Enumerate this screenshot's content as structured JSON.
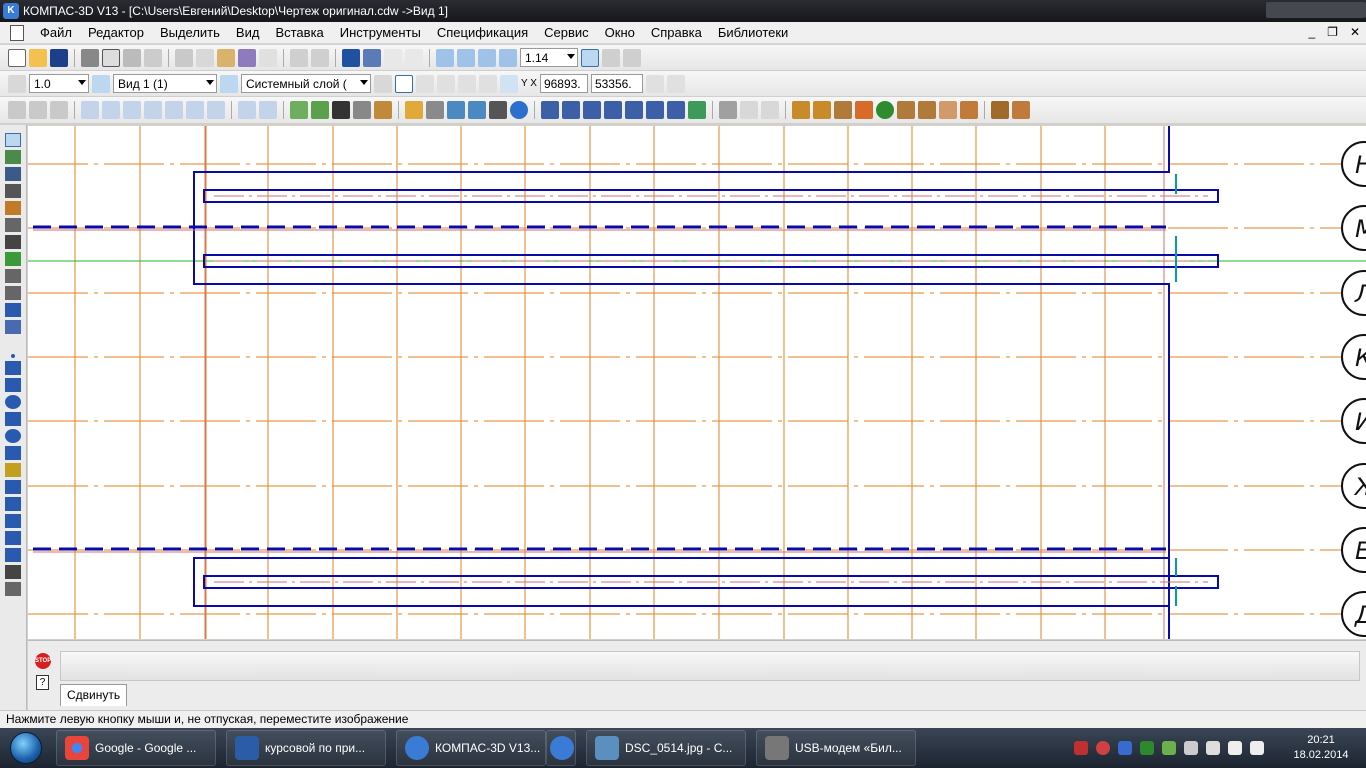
{
  "window": {
    "title": "КОМПАС-3D V13 - [C:\\Users\\Евгений\\Desktop\\Чертеж оригинал.cdw ->Вид 1]"
  },
  "menu": {
    "items": [
      "Файл",
      "Редактор",
      "Выделить",
      "Вид",
      "Вставка",
      "Инструменты",
      "Спецификация",
      "Сервис",
      "Окно",
      "Справка",
      "Библиотеки"
    ]
  },
  "toolbar1": {
    "zoom_value": "1.14"
  },
  "toolbar2": {
    "step_value": "1.0",
    "view_value": "Вид 1 (1)",
    "layer_value": "Системный слой (",
    "coord_x": "96893.",
    "coord_y": "53356.",
    "coord_label": "Y X"
  },
  "canvas": {
    "axis_labels": [
      "Н",
      "М",
      "Л",
      "К",
      "И",
      "Ж",
      "Е",
      "Д"
    ]
  },
  "command_panel": {
    "stop_label": "STOP",
    "help_label": "?",
    "tab_label": "Сдвинуть"
  },
  "status": {
    "message": "Нажмите левую кнопку мыши и, не отпуская, переместите изображение"
  },
  "taskbar": {
    "tasks": [
      {
        "label": "Google - Google ...",
        "icon": "chrome-icon",
        "color": "#e8453c"
      },
      {
        "label": "курсовой по при...",
        "icon": "word-icon",
        "color": "#2b5ca8"
      },
      {
        "label": "КОМПАС-3D V13...",
        "icon": "kompas-icon",
        "color": "#3a7bd5"
      },
      {
        "label": "",
        "icon": "kompas-icon",
        "color": "#3a7bd5"
      },
      {
        "label": "DSC_0514.jpg - С...",
        "icon": "image-viewer-icon",
        "color": "#5a8fc0"
      },
      {
        "label": "USB-модем «Бил...",
        "icon": "modem-icon",
        "color": "#777777"
      }
    ],
    "clock_time": "20:21",
    "clock_date": "18.02.2014"
  },
  "colors": {
    "construction": "#e6821e",
    "outline": "#0a0aa8",
    "center_line": "#d07070",
    "green_line": "#27b027",
    "teal_mark": "#00a0a0"
  }
}
